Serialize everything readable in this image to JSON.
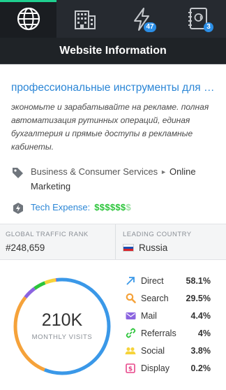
{
  "tabs": [
    {
      "name": "globe-icon",
      "active": true,
      "badge": ""
    },
    {
      "name": "building-icon",
      "active": false,
      "badge": ""
    },
    {
      "name": "lightning-icon",
      "active": false,
      "badge": "47"
    },
    {
      "name": "address-book-icon",
      "active": false,
      "badge": "3"
    }
  ],
  "header": {
    "title": "Website Information"
  },
  "site": {
    "title": "профессиональные инструменты для контекстной рекламы",
    "description": "экономьте и зарабатывайте на рекламе. полная автоматизация рутинных операций, единая бухгалтерия и прямые доступы в рекламные кабинеты."
  },
  "category": {
    "part1": "Business & Consumer Services",
    "separator": "►",
    "part2": "Online Marketing"
  },
  "tech": {
    "label": "Tech Expense:",
    "value_strong": "$$$$$$",
    "value_dim": "$"
  },
  "stats": {
    "rank_label": "GLOBAL TRAFFIC RANK",
    "rank_value": "#248,659",
    "country_label": "LEADING COUNTRY",
    "country_value": "Russia"
  },
  "visits": {
    "value": "210K",
    "label": "MONTHLY VISITS"
  },
  "traffic_sources": [
    {
      "label": "Direct",
      "value": "58.1%",
      "percent": 58.1,
      "color": "#3a98e8",
      "icon": "arrow-up-right-icon"
    },
    {
      "label": "Search",
      "value": "29.5%",
      "percent": 29.5,
      "color": "#f5a23a",
      "icon": "search-icon"
    },
    {
      "label": "Mail",
      "value": "4.4%",
      "percent": 4.4,
      "color": "#8b64e0",
      "icon": "mail-icon"
    },
    {
      "label": "Referrals",
      "value": "4%",
      "percent": 4,
      "color": "#2cc53b",
      "icon": "link-icon"
    },
    {
      "label": "Social",
      "value": "3.8%",
      "percent": 3.8,
      "color": "#f6d33a",
      "icon": "people-icon"
    },
    {
      "label": "Display",
      "value": "0.2%",
      "percent": 0.2,
      "color": "#e8468a",
      "icon": "display-ad-icon"
    }
  ],
  "colors": {
    "accent": "#2b86d6",
    "tab_active_bar": "#1fcf8f",
    "header_bg": "#1f2327",
    "badge": "#2b8ee6"
  }
}
